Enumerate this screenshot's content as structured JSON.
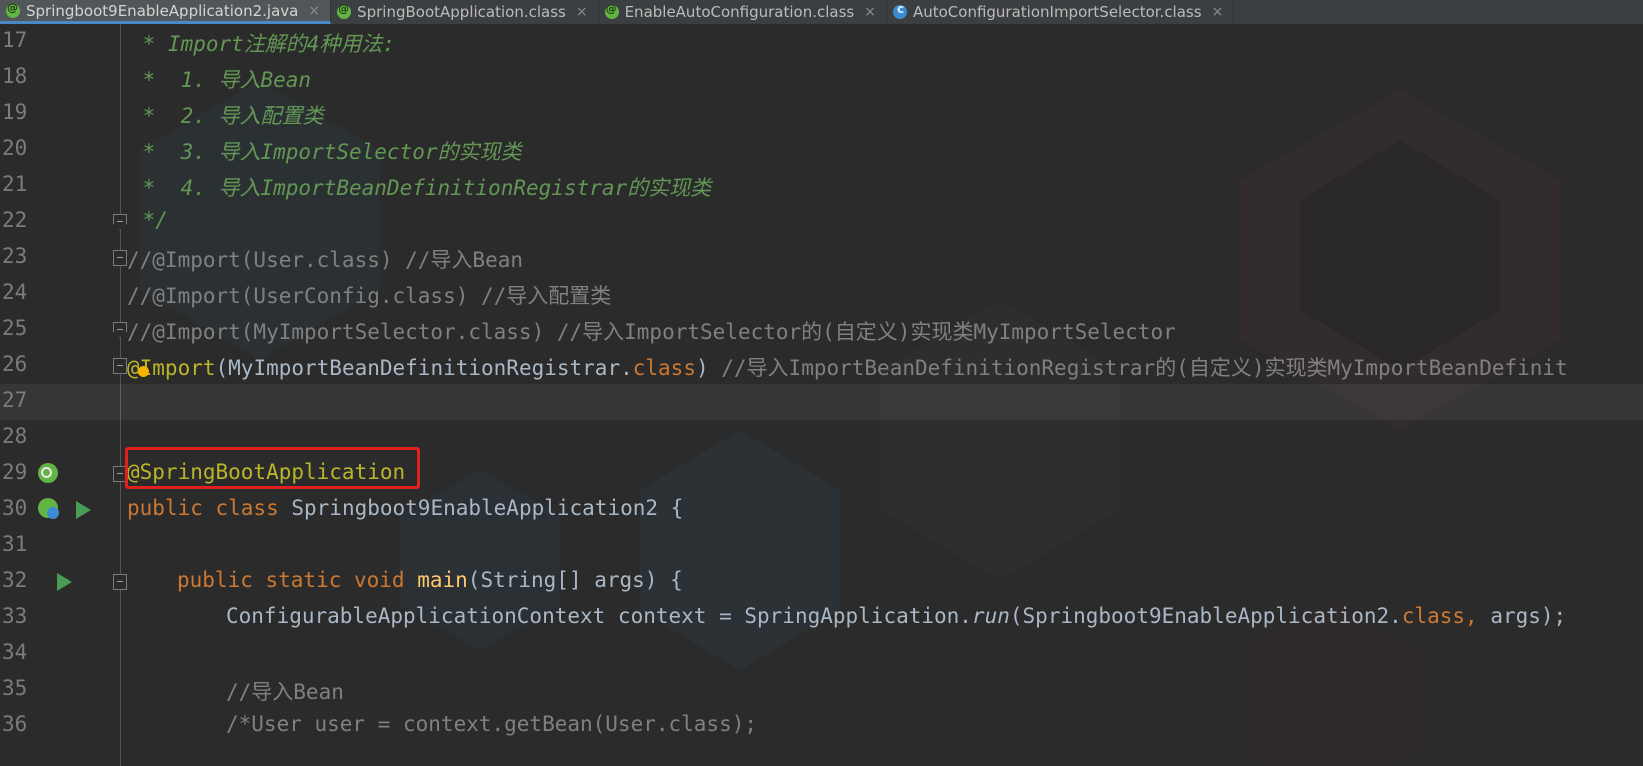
{
  "tabs": [
    {
      "label": "Springboot9EnableApplication2.java",
      "icon": "spring-java-icon",
      "active": true
    },
    {
      "label": "SpringBootApplication.class",
      "icon": "spring-annotation-icon",
      "active": false
    },
    {
      "label": "EnableAutoConfiguration.class",
      "icon": "spring-annotation-icon",
      "active": false
    },
    {
      "label": "AutoConfigurationImportSelector.class",
      "icon": "class-icon",
      "active": false
    }
  ],
  "tab_close_glyph": "×",
  "lines": [
    {
      "n": "17",
      "text": " * Import注解的4种用法:"
    },
    {
      "n": "18",
      "text": " *  1. 导入Bean"
    },
    {
      "n": "19",
      "text": " *  2. 导入配置类"
    },
    {
      "n": "20",
      "text": " *  3. 导入ImportSelector的实现类"
    },
    {
      "n": "21",
      "text": " *  4. 导入ImportBeanDefinitionRegistrar的实现类"
    },
    {
      "n": "22",
      "text": " */"
    },
    {
      "n": "23",
      "text": "//@Import(User.class) //导入Bean"
    },
    {
      "n": "24",
      "text": "//@Import(UserConfig.class) //导入配置类"
    },
    {
      "n": "25",
      "text": "//@Import(MyImportSelector.class) //导入ImportSelector的(自定义)实现类MyImportSelector"
    },
    {
      "n": "26",
      "parts": [
        "@Import",
        "(MyImportBeanDefinitionRegistrar.",
        "class",
        ") ",
        "//导入ImportBeanDefinitionRegistrar的(自定义)实现类MyImportBeanDefinit"
      ]
    },
    {
      "n": "27",
      "text": ""
    },
    {
      "n": "28",
      "text": ""
    },
    {
      "n": "29",
      "text": "@SpringBootApplication"
    },
    {
      "n": "30",
      "parts": [
        "public class ",
        "Springboot9EnableApplication2 {"
      ]
    },
    {
      "n": "31",
      "text": ""
    },
    {
      "n": "32",
      "parts": [
        "public static void ",
        "main",
        "(String[] args) {"
      ]
    },
    {
      "n": "33",
      "parts": [
        "ConfigurableApplicationContext context = SpringApplication.",
        "run",
        "(Springboot9EnableApplication2.",
        "class, ",
        "args);"
      ]
    },
    {
      "n": "34",
      "text": ""
    },
    {
      "n": "35",
      "text": "//导入Bean"
    },
    {
      "n": "36",
      "text": "/*User user = context.getBean(User.class);"
    }
  ],
  "colors": {
    "background": "#2b2b2b",
    "doc_comment": "#629755",
    "line_comment": "#808080",
    "annotation": "#bbb529",
    "keyword": "#cc7832",
    "method": "#ffc66d",
    "highlight_box": "#e0201c"
  }
}
